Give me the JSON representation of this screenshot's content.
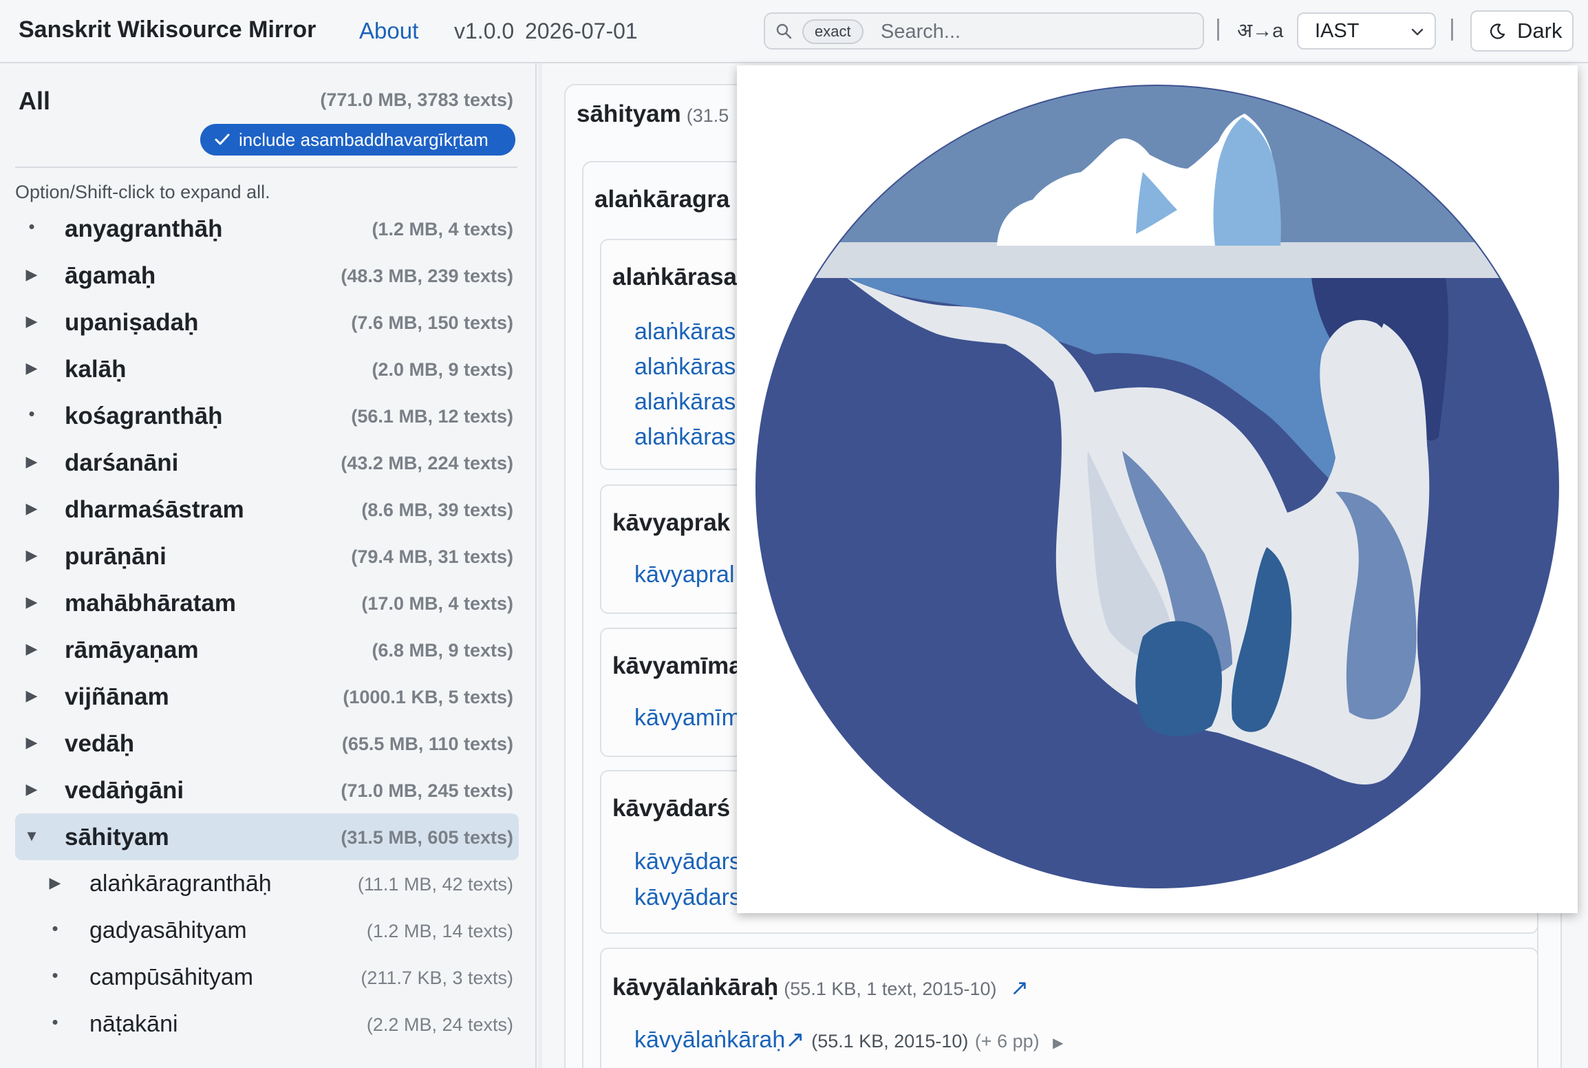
{
  "header": {
    "site_title": "Sanskrit Wikisource Mirror",
    "about_label": "About",
    "version": "v1.0.0",
    "date": "2026-07-01",
    "search_chip": "exact",
    "search_placeholder": "Search...",
    "search_value": "",
    "separator": "|",
    "translit_label": "अ→a",
    "scheme_selected": "IAST",
    "theme_label": "Dark"
  },
  "sidebar": {
    "all_label": "All",
    "all_stats": "(771.0 MB, 3783 texts)",
    "include_label": "include asambaddhavargīkṛtam",
    "hint": "Option/Shift-click to expand all.",
    "items": [
      {
        "label": "anyagranthāḥ",
        "stats": "(1.2 MB, 4 texts)",
        "marker": "•"
      },
      {
        "label": "āgamaḥ",
        "stats": "(48.3 MB, 239 texts)",
        "marker": "▶"
      },
      {
        "label": "upaniṣadaḥ",
        "stats": "(7.6 MB, 150 texts)",
        "marker": "▶"
      },
      {
        "label": "kalāḥ",
        "stats": "(2.0 MB, 9 texts)",
        "marker": "▶"
      },
      {
        "label": "kośagranthāḥ",
        "stats": "(56.1 MB, 12 texts)",
        "marker": "•"
      },
      {
        "label": "darśanāni",
        "stats": "(43.2 MB, 224 texts)",
        "marker": "▶"
      },
      {
        "label": "dharmaśāstram",
        "stats": "(8.6 MB, 39 texts)",
        "marker": "▶"
      },
      {
        "label": "purāṇāni",
        "stats": "(79.4 MB, 31 texts)",
        "marker": "▶"
      },
      {
        "label": "mahābhāratam",
        "stats": "(17.0 MB, 4 texts)",
        "marker": "▶"
      },
      {
        "label": "rāmāyaṇam",
        "stats": "(6.8 MB, 9 texts)",
        "marker": "▶"
      },
      {
        "label": "vijñānam",
        "stats": "(1000.1 KB, 5 texts)",
        "marker": "▶"
      },
      {
        "label": "vedāḥ",
        "stats": "(65.5 MB, 110 texts)",
        "marker": "▶"
      },
      {
        "label": "vedāṅgāni",
        "stats": "(71.0 MB, 245 texts)",
        "marker": "▶"
      },
      {
        "label": "sāhityam",
        "stats": "(31.5 MB, 605 texts)",
        "marker": "▼",
        "selected": true
      },
      {
        "label": "alaṅkāragranthāḥ",
        "stats": "(11.1 MB, 42 texts)",
        "marker": "▶",
        "child": true
      },
      {
        "label": "gadyasāhityam",
        "stats": "(1.2 MB, 14 texts)",
        "marker": "•",
        "child": true
      },
      {
        "label": "campūsāhityam",
        "stats": "(211.7 KB, 3 texts)",
        "marker": "•",
        "child": true
      },
      {
        "label": "nāṭakāni",
        "stats": "(2.2 MB, 24 texts)",
        "marker": "•",
        "child": true
      }
    ]
  },
  "main": {
    "section_title": "sāhityam",
    "section_meta": "(31.5",
    "sub_title": "alaṅkāragra",
    "groups": [
      {
        "title": "alaṅkārasa",
        "links": [
          "alaṅkāras",
          "alaṅkāras",
          "alaṅkāras",
          "alaṅkāras"
        ]
      },
      {
        "title": "kāvyaprak",
        "links": [
          "kāvyapral"
        ]
      },
      {
        "title": "kāvyamīma",
        "links": [
          "kāvyamīm"
        ]
      },
      {
        "title": "kāvyādarś",
        "links": [
          "kāvyādars",
          "kāvyādars"
        ]
      }
    ],
    "last_group": {
      "title": "kāvyālaṅkāraḥ",
      "meta": "(55.1 KB, 1 text, 2015-10)",
      "ext_arrow": "↗",
      "link_label": "kāvyālaṅkāraḥ",
      "link_arrow": "↗",
      "link_meta": "(55.1 KB, 2015-10)",
      "link_more": "(+ 6 pp)",
      "expand_marker": "▶"
    }
  },
  "colors": {
    "accent": "#1d62c7",
    "link": "#1a63b8",
    "logo_dark": "#3e5290",
    "logo_mid": "#5a88c0",
    "logo_light": "#e4e8ed"
  },
  "icons": {
    "search": "search-icon",
    "theme": "moon-icon",
    "select": "chevron-down-icon",
    "include": "check-icon",
    "logo": "wikisource-iceberg-logo"
  }
}
